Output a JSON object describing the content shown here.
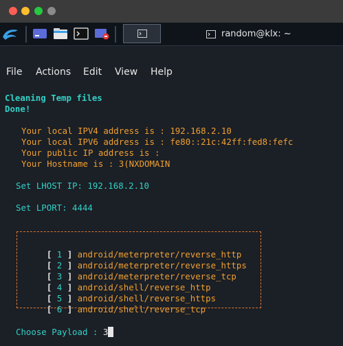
{
  "window": {
    "title": "random@klx: ~"
  },
  "menu": [
    "File",
    "Actions",
    "Edit",
    "View",
    "Help"
  ],
  "terminal": {
    "cleaning": "Cleaning Temp files",
    "done": "Done!",
    "ipv4": "Your local IPV4 address is : 192.168.2.10",
    "ipv6": "Your local IPV6 address is : fe80::21c:42ff:fed8:fefc",
    "public_ip": "Your public IP address is :",
    "hostname": "Your Hostname is : 3(NXDOMAIN",
    "lhost": "Set LHOST IP: 192.168.2.10",
    "lport": "Set LPORT: 4444",
    "payloads": [
      {
        "num": "1",
        "name": "android/meterpreter/reverse_http"
      },
      {
        "num": "2",
        "name": "android/meterpreter/reverse_https"
      },
      {
        "num": "3",
        "name": "android/meterpreter/reverse_tcp"
      },
      {
        "num": "4",
        "name": "android/shell/reverse_http"
      },
      {
        "num": "5",
        "name": "android/shell/reverse_https"
      },
      {
        "num": "6",
        "name": "android/shell/reverse_tcp"
      }
    ],
    "prompt": "Choose Payload : ",
    "input": "3"
  },
  "colors": {
    "cyan": "#33d1c6",
    "orange": "#f0a030",
    "box_border": "#e07a2e",
    "background": "#1b1f26"
  },
  "icons": [
    "kali-dragon-icon",
    "workspace-icon",
    "file-manager-icon",
    "terminal-icon",
    "screen-recorder-icon"
  ]
}
